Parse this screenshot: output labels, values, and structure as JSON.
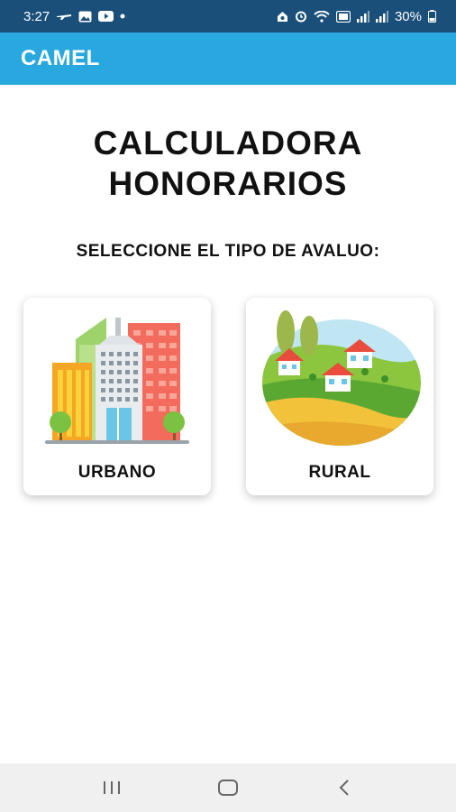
{
  "status_bar": {
    "time": "3:27",
    "battery": "30%",
    "icons": [
      "airplane-icon",
      "gallery-icon",
      "youtube-icon",
      "dot-icon",
      "alarm-icon",
      "alarm-clock-icon",
      "wifi-icon",
      "lte-icon",
      "signal-icon",
      "signal-icon",
      "battery-icon"
    ]
  },
  "app_bar": {
    "title": "CAMEL"
  },
  "main": {
    "heading_line1": "CALCULADORA",
    "heading_line2": "HONORARIOS",
    "subtitle": "SELECCIONE EL TIPO DE AVALUO:",
    "options": [
      {
        "label": "URBANO",
        "icon": "city-buildings-icon"
      },
      {
        "label": "RURAL",
        "icon": "countryside-houses-icon"
      }
    ]
  },
  "nav_bar": {
    "buttons": [
      "recent-apps-icon",
      "home-icon",
      "back-icon"
    ]
  },
  "colors": {
    "status_bar": "#1a4f7a",
    "app_bar": "#29a8df",
    "background": "#ffffff",
    "nav_bar": "#f0f0f0"
  }
}
